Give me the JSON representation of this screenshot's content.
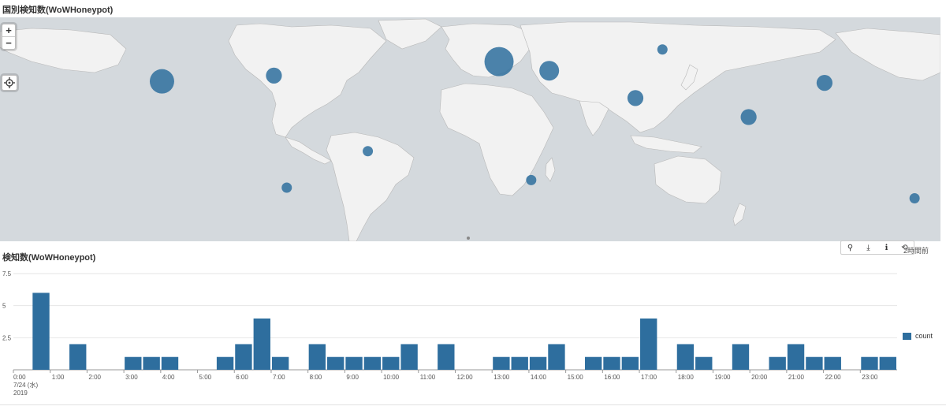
{
  "map_panel": {
    "title": "国別検知数(WoWHoneypot)",
    "zoom_in_label": "+",
    "zoom_out_label": "−",
    "locate_icon": "crosshair-icon",
    "marker_color": "#2e6e9e",
    "markers": [
      {
        "location": "Western USA",
        "lon": -119.5,
        "lat": 37.0,
        "relative_size": 1.0
      },
      {
        "location": "Eastern USA",
        "lon": -76.0,
        "lat": 40.8,
        "relative_size": 0.55
      },
      {
        "location": "Brazil",
        "lon": -39.5,
        "lat": -9.0,
        "relative_size": 0.25
      },
      {
        "location": "Chile",
        "lon": -71.0,
        "lat": -33.0,
        "relative_size": 0.25
      },
      {
        "location": "Western/Central Europe",
        "lon": 11.5,
        "lat": 50.0,
        "relative_size": 1.25
      },
      {
        "location": "Ukraine",
        "lon": 31.0,
        "lat": 44.0,
        "relative_size": 0.75
      },
      {
        "location": "Russia",
        "lon": 75.0,
        "lat": 58.0,
        "relative_size": 0.25
      },
      {
        "location": "South Africa",
        "lon": 24.0,
        "lat": -28.0,
        "relative_size": 0.25
      },
      {
        "location": "Pakistan",
        "lon": 64.5,
        "lat": 26.0,
        "relative_size": 0.55
      },
      {
        "location": "Vietnam",
        "lon": 108.5,
        "lat": 13.5,
        "relative_size": 0.55
      },
      {
        "location": "Japan",
        "lon": 138.0,
        "lat": 36.0,
        "relative_size": 0.55
      },
      {
        "location": "New Zealand",
        "lon": 173.0,
        "lat": -40.0,
        "relative_size": 0.25
      }
    ]
  },
  "chart_panel": {
    "title": "検知数(WoWHoneypot)",
    "toolbar": {
      "search_icon": "⚲",
      "download_icon": "⤓",
      "info_icon": "ℹ",
      "refresh_icon": "⟲"
    },
    "timestamp": "2時間前",
    "date_label_line1": "7/24 (水)",
    "date_label_line2": "2019"
  },
  "chart_data": {
    "type": "bar",
    "x_unit": "30 minutes",
    "x_start": "0:00",
    "tick_labels": [
      "0:00",
      "1:00",
      "2:00",
      "3:00",
      "4:00",
      "5:00",
      "6:00",
      "7:00",
      "8:00",
      "9:00",
      "10:00",
      "11:00",
      "12:00",
      "13:00",
      "14:00",
      "15:00",
      "16:00",
      "17:00",
      "18:00",
      "19:00",
      "20:00",
      "21:00",
      "22:00",
      "23:00"
    ],
    "y_ticks": [
      "2.5",
      "5",
      "7.5"
    ],
    "ylim": [
      0,
      7.5
    ],
    "series": [
      {
        "name": "count",
        "color": "#2e6e9e",
        "values": [
          0,
          6,
          0,
          2,
          0,
          0,
          1,
          1,
          1,
          0,
          0,
          1,
          2,
          4,
          1,
          0,
          2,
          1,
          1,
          1,
          1,
          2,
          0,
          2,
          0,
          0,
          1,
          1,
          1,
          2,
          0,
          1,
          1,
          1,
          4,
          0,
          2,
          1,
          0,
          2,
          0,
          1,
          2,
          1,
          1,
          0,
          1,
          1
        ]
      }
    ],
    "legend_label": "count",
    "legend_position": "right",
    "grid": true
  }
}
